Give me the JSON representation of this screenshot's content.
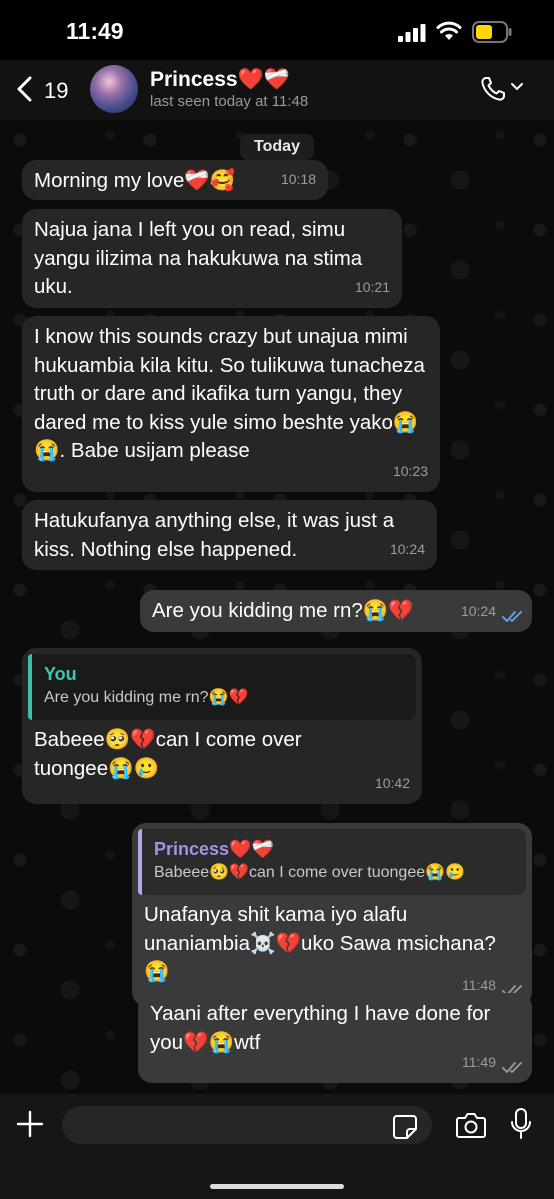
{
  "status_bar": {
    "time": "11:49"
  },
  "header": {
    "back_count": "19",
    "contact_name": "Princess❤️❤️‍🩹",
    "last_seen": "last seen today at 11:48"
  },
  "chat": {
    "date_label": "Today",
    "messages": [
      {
        "direction": "in",
        "text": "Morning my love❤️‍🩹🥰",
        "time": "10:18"
      },
      {
        "direction": "in",
        "text": "Najua jana I left you on read, simu yangu ilizima na hakukuwa na stima uku.",
        "time": "10:21"
      },
      {
        "direction": "in",
        "text": "I know this sounds crazy but unajua mimi hukuambia kila kitu. So tulikuwa tunacheza truth or dare and ikafika turn yangu, they dared me to kiss yule simo beshte yako😭😭. Babe usijam please",
        "time": "10:23"
      },
      {
        "direction": "in",
        "text": "Hatukufanya anything else, it was just a kiss. Nothing else happened.",
        "time": "10:24"
      },
      {
        "direction": "out",
        "text": "Are you kidding me rn?😭💔",
        "time": "10:24",
        "read": true
      },
      {
        "direction": "in",
        "quote_author": "You",
        "quote_text": "Are you kidding me rn?😭💔",
        "text": "Babeee🥺💔can I come over tuongee😭🥲",
        "time": "10:42"
      },
      {
        "direction": "out",
        "quote_author": "Princess❤️❤️‍🩹",
        "quote_text": "Babeee🥺💔can I come over tuongee😭🥲",
        "text": "Unafanya shit kama iyo alafu unaniambia☠️💔uko Sawa msichana?😭",
        "time": "11:48",
        "read": false
      },
      {
        "direction": "out",
        "text": "Yaani after everything I have done for you💔😭wtf",
        "time": "11:49",
        "read": false
      }
    ]
  },
  "input_bar": {
    "placeholder": ""
  },
  "colors": {
    "incoming_bubble": "#262626",
    "outgoing_bubble": "#3a3a3a",
    "read_ticks": "#5ea8ff",
    "delivered_ticks": "#9c9c9c",
    "quote_you": "#3fc6ad",
    "quote_princess": "#a98fe6"
  }
}
